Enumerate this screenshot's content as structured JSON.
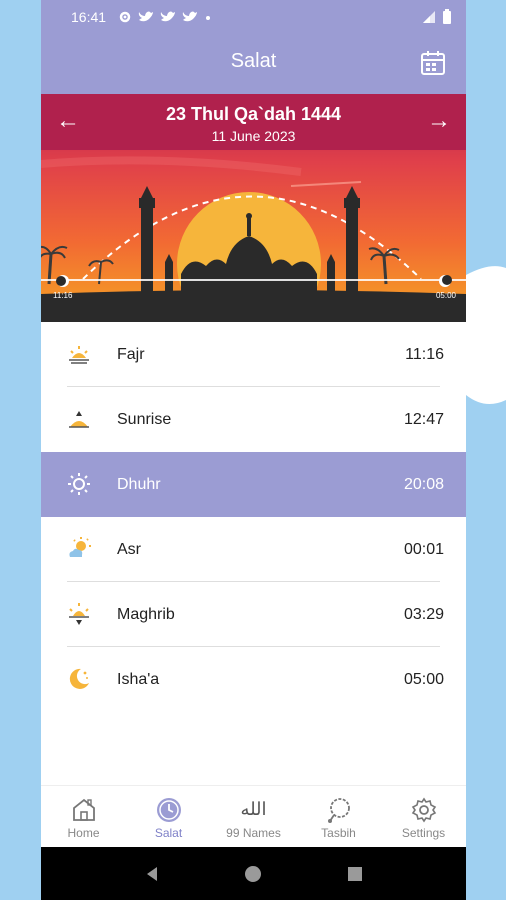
{
  "status_bar": {
    "time": "16:41"
  },
  "app_bar": {
    "title": "Salat"
  },
  "hero": {
    "hijri_date": "23 Thul Qa`dah 1444",
    "gregorian_date": "11 June 2023",
    "start_time": "11:16",
    "end_time": "05:00"
  },
  "prayers": [
    {
      "name": "Fajr",
      "time": "11:16",
      "icon": "sun-dawn-icon"
    },
    {
      "name": "Sunrise",
      "time": "12:47",
      "icon": "sunrise-icon"
    },
    {
      "name": "Dhuhr",
      "time": "20:08",
      "icon": "sun-icon",
      "active": true
    },
    {
      "name": "Asr",
      "time": "00:01",
      "icon": "sun-cloud-icon"
    },
    {
      "name": "Maghrib",
      "time": "03:29",
      "icon": "sunset-icon"
    },
    {
      "name": "Isha'a",
      "time": "05:00",
      "icon": "moon-icon"
    }
  ],
  "nav": [
    {
      "label": "Home",
      "icon": "home-icon"
    },
    {
      "label": "Salat",
      "icon": "clock-icon",
      "active": true
    },
    {
      "label": "99 Names",
      "icon": "allah-calligraphy-icon",
      "glyph": "الله"
    },
    {
      "label": "Tasbih",
      "icon": "tasbih-icon"
    },
    {
      "label": "Settings",
      "icon": "gear-icon"
    }
  ],
  "colors": {
    "accent": "#9b9cd3",
    "active_nav": "#7f81c8",
    "sky_top": "#b3204f",
    "sky_bottom": "#f5a623",
    "sun": "#f6b53b",
    "silhouette": "#2a2a2a"
  }
}
